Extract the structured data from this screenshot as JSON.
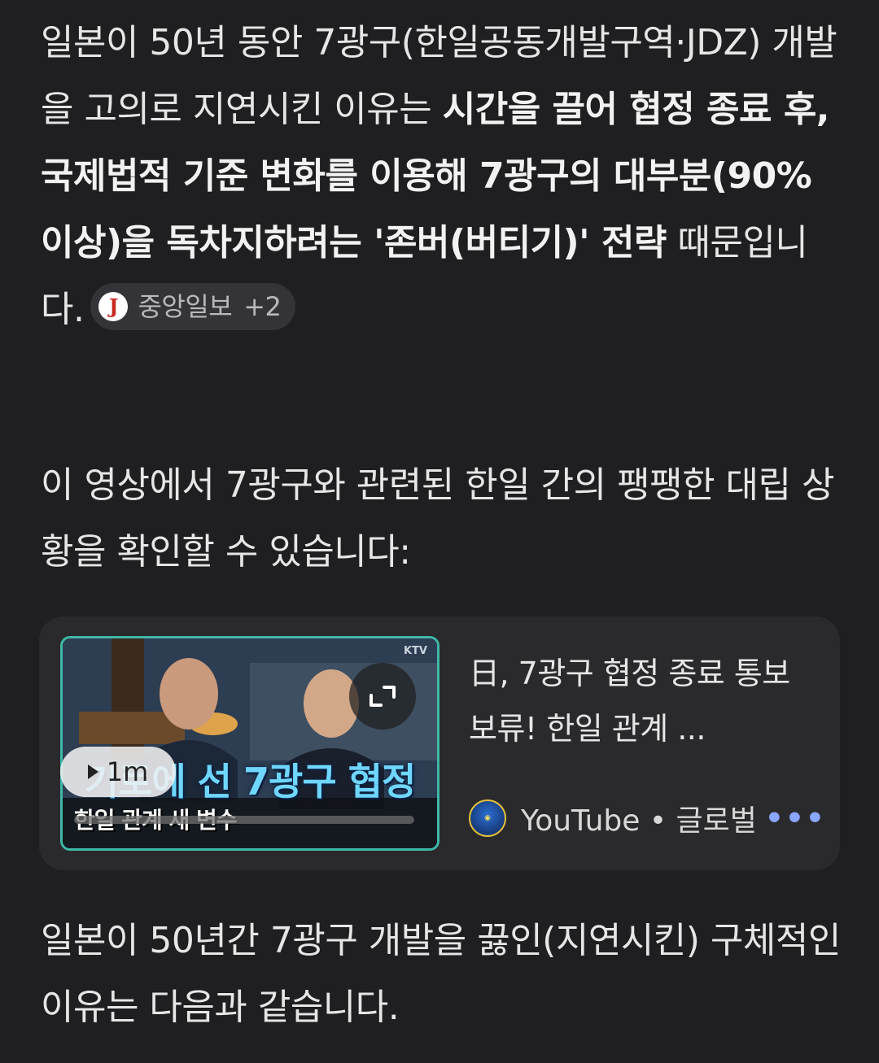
{
  "paragraph1": {
    "normal_start": "일본이 50년 동안 7광구(한일공동개발구역·JDZ) 개발을 고의로 지연시킨 이유는 ",
    "bold": "시간을 끌어 협정 종료 후, 국제법적 기준 변화를 이용해 7광구의 대부분(90% 이상)을 독차지하려는 '존버(버티기)' 전략",
    "normal_end": " 때문입니다."
  },
  "source_chip": {
    "logo_letter": "J",
    "name": "중앙일보",
    "more": "+2"
  },
  "paragraph2": "이 영상에서 7광구와 관련된 한일 간의 팽팽한 대립 상황을 확인할 수 있습니다:",
  "video_card": {
    "thumbnail": {
      "watermark": "KTV",
      "headline": "기로에 선 7광구 협정",
      "subtitle": "한일 관계 새 변수",
      "duration": "1m"
    },
    "title": "日, 7광구 협정 종료 통보 보류! 한일 관계 ...",
    "source": "YouTube • 글로벌",
    "ellipsis": "•••"
  },
  "paragraph3": "일본이 50년간 7광구 개발을 끓인(지연시킨) 구체적인 이유는 다음과 같습니다."
}
